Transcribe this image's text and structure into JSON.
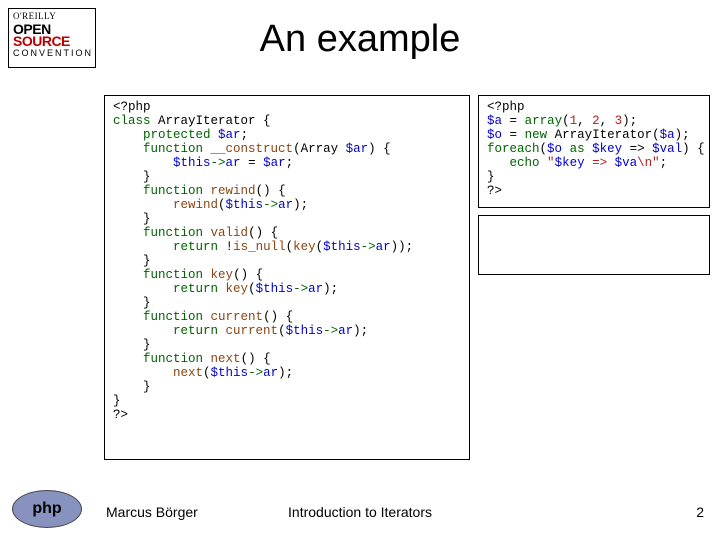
{
  "logo": {
    "l1": "O'REILLY",
    "l2": "OPEN",
    "l3": "SOURCE",
    "l4": "CONVENTION"
  },
  "title": "An example",
  "code_left_html": "<span class='pl'>&lt;?php</span>\n<span class='kw'>class</span> <span class='pl'>ArrayIterator {</span>\n    <span class='kw'>protected</span> <span class='var'>$ar</span><span class='pl'>;</span>\n    <span class='kw'>function</span> <span class='fn'>__construct</span><span class='pl'>(Array </span><span class='var'>$ar</span><span class='pl'>) {</span>\n        <span class='var'>$this</span><span class='arw'>-&gt;</span><span class='var'>ar</span> <span class='pl'>=</span> <span class='var'>$ar</span><span class='pl'>;</span>\n    <span class='pl'>}</span>\n    <span class='kw'>function</span> <span class='fn'>rewind</span><span class='pl'>() {</span>\n        <span class='fn'>rewind</span><span class='pl'>(</span><span class='var'>$this</span><span class='arw'>-&gt;</span><span class='var'>ar</span><span class='pl'>);</span>\n    <span class='pl'>}</span>\n    <span class='kw'>function</span> <span class='fn'>valid</span><span class='pl'>() {</span>\n        <span class='kw'>return</span> <span class='pl'>!</span><span class='fn'>is_null</span><span class='pl'>(</span><span class='fn'>key</span><span class='pl'>(</span><span class='var'>$this</span><span class='arw'>-&gt;</span><span class='var'>ar</span><span class='pl'>));</span>\n    <span class='pl'>}</span>\n    <span class='kw'>function</span> <span class='fn'>key</span><span class='pl'>() {</span>\n        <span class='kw'>return</span> <span class='fn'>key</span><span class='pl'>(</span><span class='var'>$this</span><span class='arw'>-&gt;</span><span class='var'>ar</span><span class='pl'>);</span>\n    <span class='pl'>}</span>\n    <span class='kw'>function</span> <span class='fn'>current</span><span class='pl'>() {</span>\n        <span class='kw'>return</span> <span class='fn'>current</span><span class='pl'>(</span><span class='var'>$this</span><span class='arw'>-&gt;</span><span class='var'>ar</span><span class='pl'>);</span>\n    <span class='pl'>}</span>\n    <span class='kw'>function</span> <span class='fn'>next</span><span class='pl'>() {</span>\n        <span class='fn'>next</span><span class='pl'>(</span><span class='var'>$this</span><span class='arw'>-&gt;</span><span class='var'>ar</span><span class='pl'>);</span>\n    <span class='pl'>}</span>\n<span class='pl'>}</span>\n<span class='pl'>?&gt;</span>",
  "code_right_top_html": "<span class='pl'>&lt;?php</span>\n<span class='var'>$a</span> <span class='pl'>=</span> <span class='kw'>array</span><span class='pl'>(</span><span class='lit'>1</span><span class='pl'>, </span><span class='lit'>2</span><span class='pl'>, </span><span class='lit'>3</span><span class='pl'>);</span>\n<span class='var'>$o</span> <span class='pl'>=</span> <span class='kw'>new</span> <span class='pl'>ArrayIterator(</span><span class='var'>$a</span><span class='pl'>);</span>\n<span class='kw'>foreach</span><span class='pl'>(</span><span class='var'>$o</span> <span class='kw'>as</span> <span class='var'>$key</span> <span class='pl'>=&gt;</span> <span class='var'>$val</span><span class='pl'>) {</span>\n   <span class='kw'>echo</span> <span class='lit'>\"</span><span class='var'>$key</span><span class='lit'> =&gt; </span><span class='var'>$va</span><span class='lit'>\\n\"</span><span class='pl'>;</span>\n<span class='pl'>}</span>\n<span class='pl'>?&gt;</span>",
  "code_right_bot_html": "",
  "php_logo_text": "php",
  "footer": {
    "author": "Marcus Börger",
    "title": "Introduction to Iterators",
    "page": "2"
  }
}
